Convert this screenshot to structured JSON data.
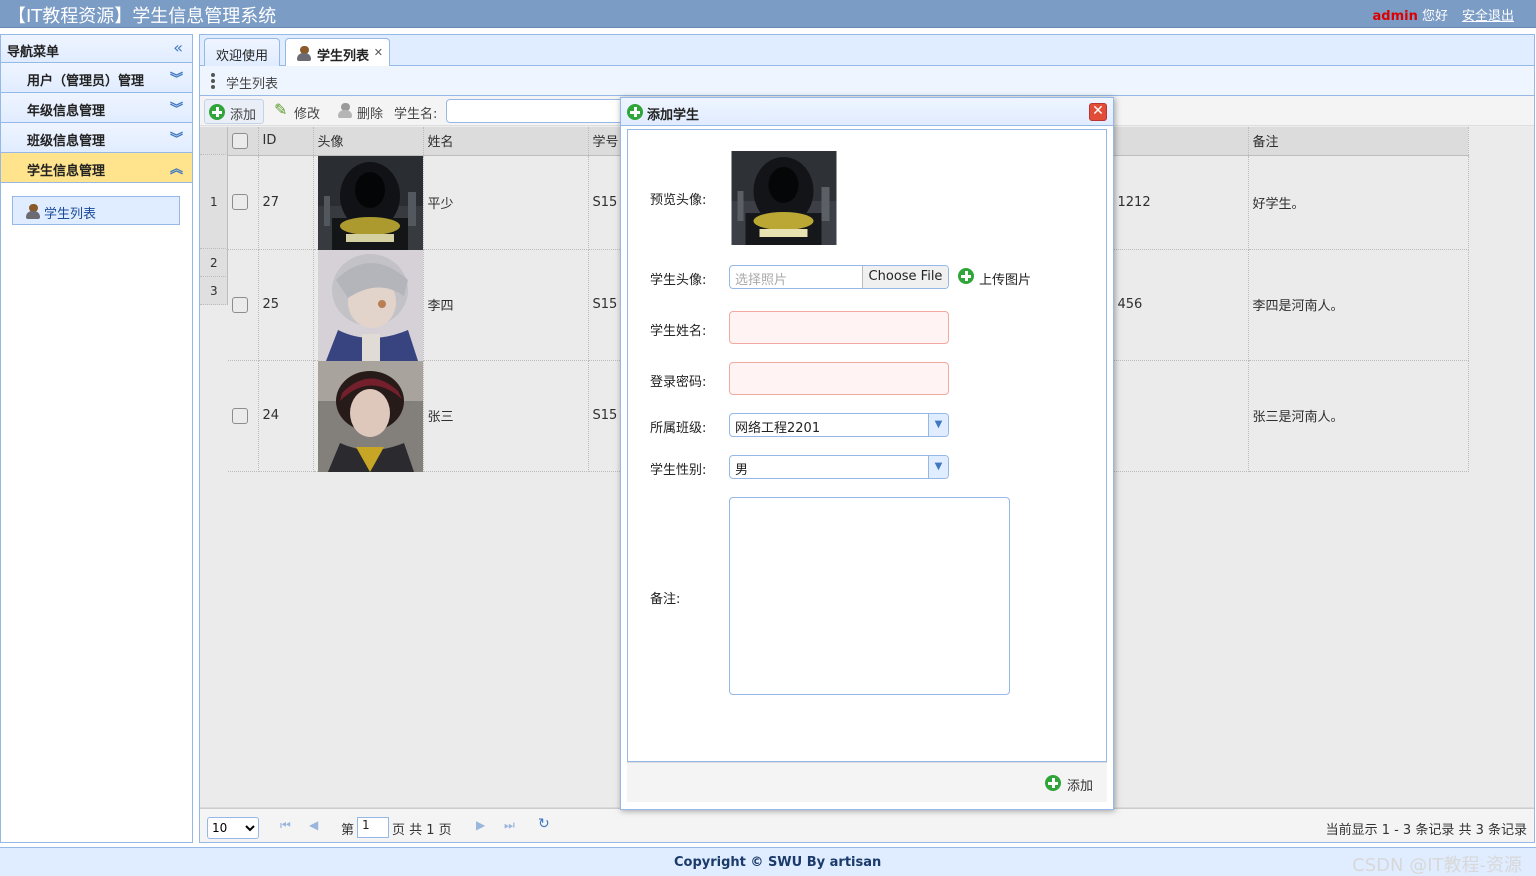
{
  "header": {
    "title": "【IT教程资源】学生信息管理系统",
    "user": "admin",
    "greeting": "您好",
    "logout": "安全退出"
  },
  "nav": {
    "title": "导航菜单",
    "sections": [
      {
        "label": "用户（管理员）管理"
      },
      {
        "label": "年级信息管理"
      },
      {
        "label": "班级信息管理"
      },
      {
        "label": "学生信息管理"
      }
    ],
    "link": "学生列表"
  },
  "tabs": [
    {
      "label": "欢迎使用"
    },
    {
      "label": "学生列表"
    }
  ],
  "grid": {
    "title": "学生列表",
    "toolbar": {
      "add": "添加",
      "edit": "修改",
      "delete": "删除",
      "search_label": "学生名:"
    },
    "columns": [
      "ID",
      "头像",
      "姓名",
      "学号",
      "备注"
    ],
    "row_numbers": [
      "1",
      "2",
      "3"
    ],
    "rows": [
      {
        "id": "27",
        "name": "平少",
        "sn": "S15",
        "extra": "1212",
        "remark": "好学生。"
      },
      {
        "id": "25",
        "name": "李四",
        "sn": "S15",
        "extra": "456",
        "remark": "李四是河南人。"
      },
      {
        "id": "24",
        "name": "张三",
        "sn": "S15",
        "extra": "",
        "remark": "张三是河南人。"
      }
    ]
  },
  "pager": {
    "page_size": "10",
    "page_prefix": "第",
    "page_value": "1",
    "page_suffix": "页 共 1 页",
    "info": "当前显示 1 - 3 条记录 共 3 条记录"
  },
  "dialog": {
    "title": "添加学生",
    "preview_label": "预览头像:",
    "avatar_label": "学生头像:",
    "file_placeholder": "选择照片",
    "choose_file": "Choose File",
    "upload": "上传图片",
    "name_label": "学生姓名:",
    "password_label": "登录密码:",
    "class_label": "所属班级:",
    "class_value": "网络工程2201",
    "gender_label": "学生性别:",
    "gender_value": "男",
    "remark_label": "备注:",
    "submit": "添加"
  },
  "footer": {
    "copyright": "Copyright © SWU By artisan",
    "watermark": "CSDN @IT教程-资源"
  },
  "colors": {
    "header_bg": "#7b9cc5",
    "panel_border": "#95b8e7",
    "selected_nav": "#ffe48d",
    "add_green": "#2fa53a",
    "close_red": "#e24d38",
    "required_bg": "#fff3f3"
  }
}
